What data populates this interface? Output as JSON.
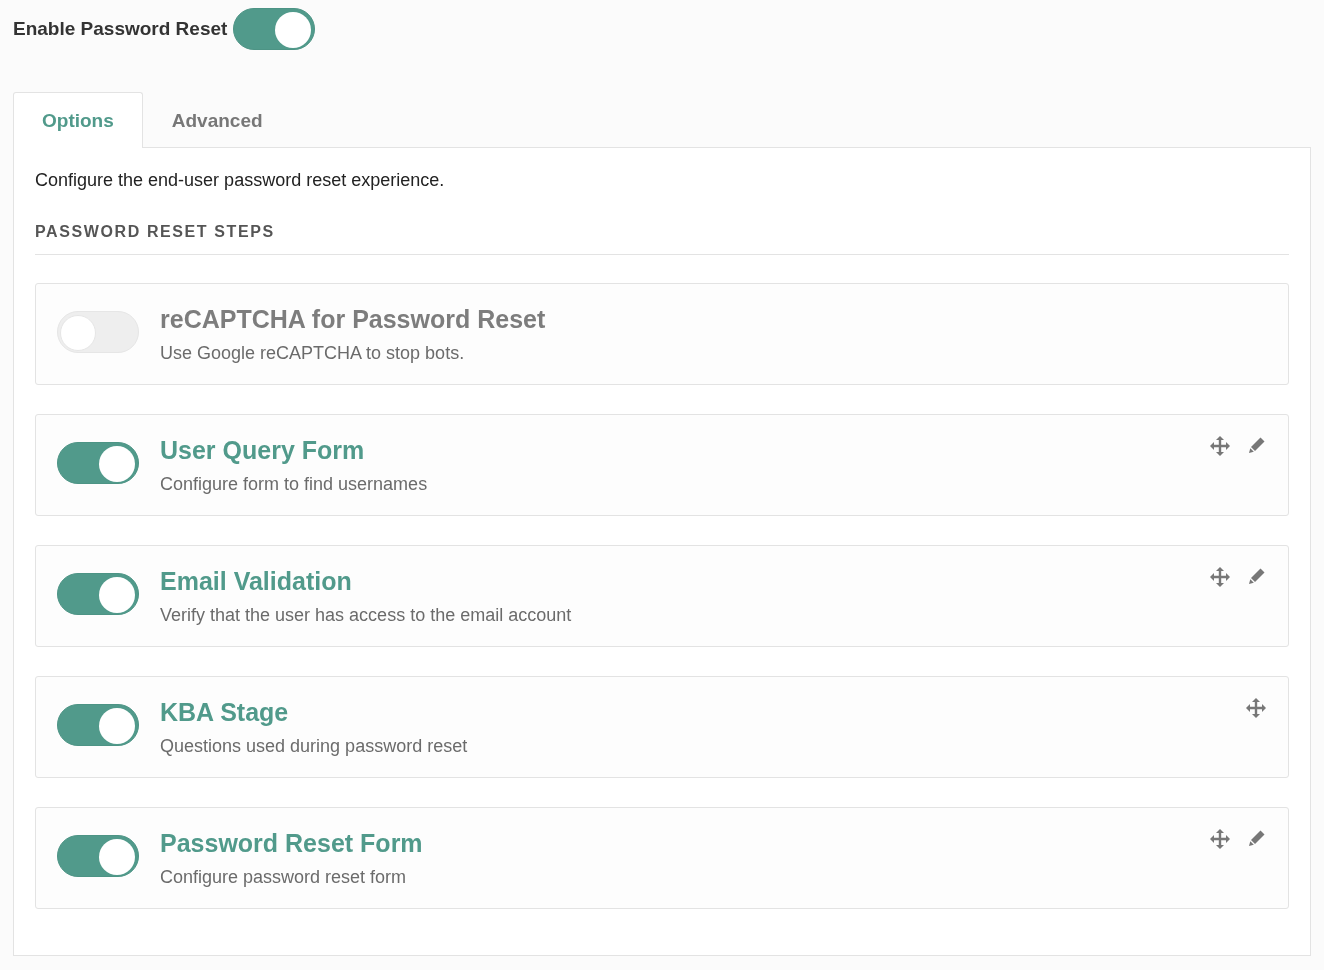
{
  "header": {
    "label": "Enable Password Reset",
    "on": true
  },
  "tabs": [
    {
      "label": "Options",
      "selected": true
    },
    {
      "label": "Advanced",
      "selected": false
    }
  ],
  "intro": "Configure the end-user password reset experience.",
  "section_title": "PASSWORD RESET STEPS",
  "steps": [
    {
      "title": "reCAPTCHA for Password Reset",
      "description": "Use Google reCAPTCHA to stop bots.",
      "on": false,
      "movable": false,
      "editable": false
    },
    {
      "title": "User Query Form",
      "description": "Configure form to find usernames",
      "on": true,
      "movable": true,
      "editable": true
    },
    {
      "title": "Email Validation",
      "description": "Verify that the user has access to the email account",
      "on": true,
      "movable": true,
      "editable": true
    },
    {
      "title": "KBA Stage",
      "description": "Questions used during password reset",
      "on": true,
      "movable": true,
      "editable": false
    },
    {
      "title": "Password Reset Form",
      "description": "Configure password reset form",
      "on": true,
      "movable": true,
      "editable": true
    }
  ]
}
